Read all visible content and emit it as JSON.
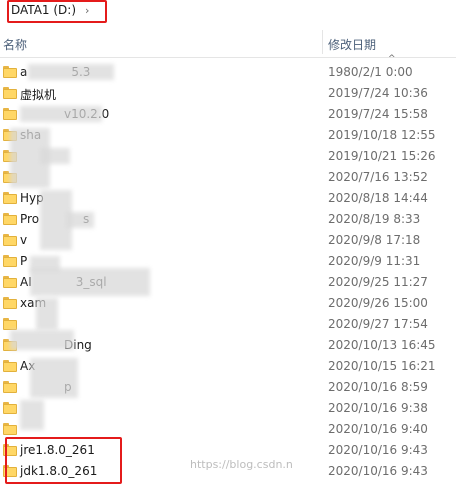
{
  "breadcrumb": {
    "drive_label": "DATA1 (D:)",
    "chevron": "›"
  },
  "columns": {
    "name": "名称",
    "date_modified": "修改日期",
    "sort_indicator": "^"
  },
  "files": [
    {
      "name": "a",
      "suffix": "5.3",
      "date": "1980/2/1 0:00"
    },
    {
      "name": "虚拟机",
      "suffix": "",
      "date": "2019/7/24 10:36"
    },
    {
      "name": "",
      "suffix": "v10.2.0",
      "date": "2019/7/24 15:58"
    },
    {
      "name": "sha",
      "suffix": "",
      "date": "2019/10/18 12:55"
    },
    {
      "name": "",
      "suffix": "",
      "date": "2019/10/21 15:26"
    },
    {
      "name": "",
      "suffix": "",
      "date": "2020/7/16 13:52"
    },
    {
      "name": "Hyp",
      "suffix": "",
      "date": "2020/8/18 14:44"
    },
    {
      "name": "Pro",
      "suffix": "s",
      "date": "2020/8/19 8:33"
    },
    {
      "name": "v",
      "suffix": "",
      "date": "2020/9/8 17:18"
    },
    {
      "name": "P",
      "suffix": "",
      "date": "2020/9/9 11:31"
    },
    {
      "name": "AI",
      "suffix": "3_sql",
      "date": "2020/9/25 11:27"
    },
    {
      "name": "xam",
      "suffix": "",
      "date": "2020/9/26 15:00"
    },
    {
      "name": "",
      "suffix": "",
      "date": "2020/9/27 17:54"
    },
    {
      "name": "",
      "suffix": "Ding",
      "date": "2020/10/13 16:45"
    },
    {
      "name": "Ax",
      "suffix": "",
      "date": "2020/10/15 16:21"
    },
    {
      "name": "",
      "suffix": "p",
      "date": "2020/10/16 8:59"
    },
    {
      "name": "",
      "suffix": "",
      "date": "2020/10/16 9:38"
    },
    {
      "name": "",
      "suffix": "",
      "date": "2020/10/16 9:40"
    },
    {
      "name": "jre1.8.0_261",
      "suffix": "",
      "date": "2020/10/16 9:43"
    },
    {
      "name": "jdk1.8.0_261",
      "suffix": "",
      "date": "2020/10/16 9:43"
    }
  ],
  "watermark": "https://blog.csdn.n"
}
